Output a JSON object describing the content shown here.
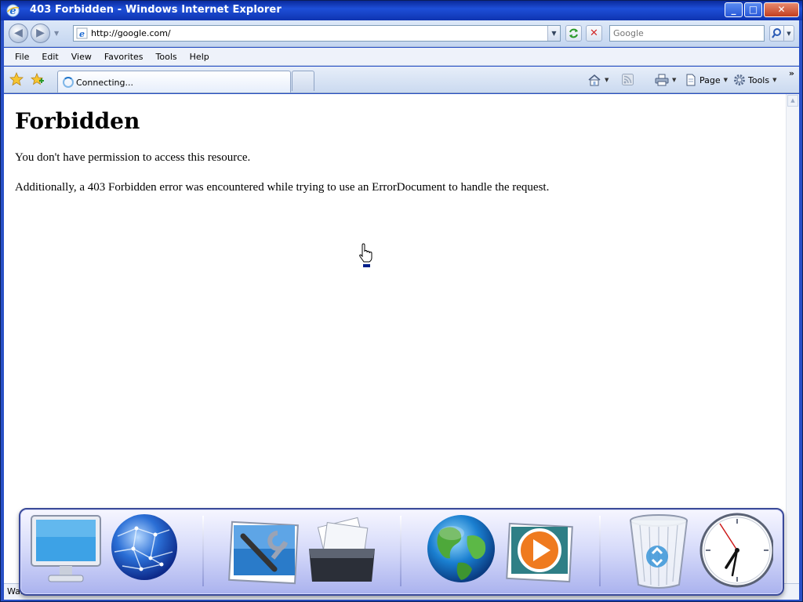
{
  "window": {
    "title": "403 Forbidden - Windows Internet Explorer",
    "controls": {
      "minimize": "_",
      "maximize": "□",
      "close": "✕"
    }
  },
  "navbar": {
    "back_label": "◀",
    "forward_label": "▶",
    "url": "http://google.com/",
    "search_placeholder": "Google"
  },
  "menu": {
    "items": [
      "File",
      "Edit",
      "View",
      "Favorites",
      "Tools",
      "Help"
    ]
  },
  "tabs": {
    "active": {
      "label": "Connecting..."
    }
  },
  "commandbar": {
    "page_label": "Page",
    "tools_label": "Tools",
    "more": "»"
  },
  "page": {
    "heading": "Forbidden",
    "paragraph1": "You don't have permission to access this resource.",
    "paragraph2": "Additionally, a 403 Forbidden error was encountered while trying to use an ErrorDocument to handle the request."
  },
  "statusbar": {
    "text": "Wait"
  },
  "dock": {
    "items": [
      {
        "icon": "monitor-icon"
      },
      {
        "icon": "network-globe-icon"
      },
      {
        "icon": "control-panel-icon"
      },
      {
        "icon": "documents-folder-icon"
      },
      {
        "icon": "internet-globe-icon"
      },
      {
        "icon": "media-player-icon"
      },
      {
        "icon": "recycle-bin-icon"
      },
      {
        "icon": "clock-icon"
      }
    ]
  },
  "colors": {
    "title_bar": "#1e4fd8",
    "toolbar_bg": "#dde8f8",
    "dock_border": "#3a4a98"
  }
}
